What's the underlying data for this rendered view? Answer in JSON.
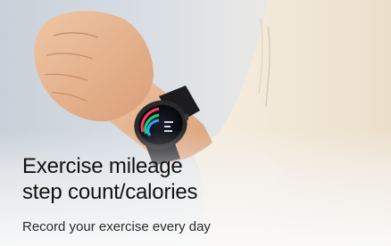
{
  "banner": {
    "headline_line1": "Exercise mileage",
    "headline_line2": "step count/calories",
    "subline": "Record your exercise every day"
  },
  "colors": {
    "background_left": "#c8d0d9",
    "background_right": "#f1ece4",
    "sleeve": "#f3e9d9",
    "skin": "#e7b893",
    "watch_body": "#1c1c1e",
    "text": "#111111"
  },
  "icons": {
    "product": "smartwatch-icon"
  }
}
